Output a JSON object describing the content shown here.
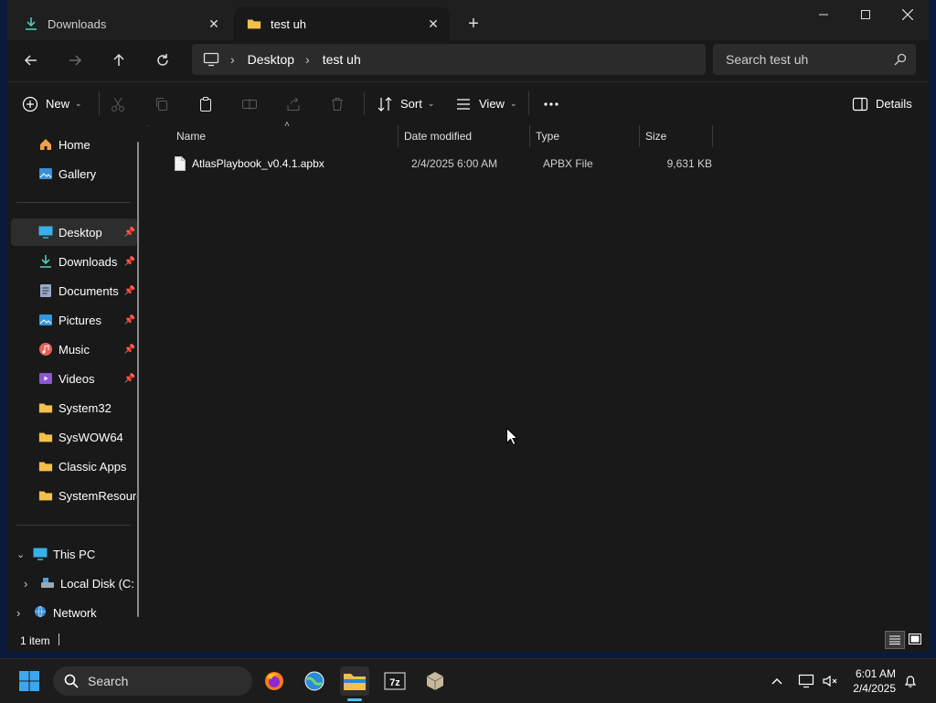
{
  "tabs": [
    {
      "label": "Downloads",
      "icon": "download-icon",
      "active": false
    },
    {
      "label": "test uh",
      "icon": "folder-icon",
      "active": true
    }
  ],
  "address": {
    "segments": [
      "Desktop",
      "test uh"
    ]
  },
  "search": {
    "placeholder": "Search test uh"
  },
  "toolbar": {
    "new_label": "New",
    "sort_label": "Sort",
    "view_label": "View",
    "details_label": "Details"
  },
  "sidebar": {
    "items": [
      {
        "label": "Home",
        "icon": "home-icon"
      },
      {
        "label": "Gallery",
        "icon": "gallery-icon"
      },
      {
        "label": "Desktop",
        "icon": "desktop-icon",
        "pinned": true,
        "selected": true
      },
      {
        "label": "Downloads",
        "icon": "download-icon",
        "pinned": true
      },
      {
        "label": "Documents",
        "icon": "documents-icon",
        "pinned": true
      },
      {
        "label": "Pictures",
        "icon": "pictures-icon",
        "pinned": true
      },
      {
        "label": "Music",
        "icon": "music-icon",
        "pinned": true
      },
      {
        "label": "Videos",
        "icon": "videos-icon",
        "pinned": true
      },
      {
        "label": "System32",
        "icon": "folder-icon"
      },
      {
        "label": "SysWOW64",
        "icon": "folder-icon"
      },
      {
        "label": "Classic Apps",
        "icon": "folder-icon"
      },
      {
        "label": "SystemResourc",
        "icon": "folder-icon"
      }
    ],
    "this_pc": "This PC",
    "local_disk": "Local Disk (C:",
    "network": "Network"
  },
  "columns": [
    "Name",
    "Date modified",
    "Type",
    "Size"
  ],
  "files": [
    {
      "name": "AtlasPlaybook_v0.4.1.apbx",
      "date": "2/4/2025 6:00 AM",
      "type": "APBX File",
      "size": "9,631 KB"
    }
  ],
  "status": {
    "count": "1 item"
  },
  "taskbar": {
    "search_label": "Search",
    "time": "6:01 AM",
    "date": "2/4/2025"
  },
  "colors": {
    "accent": "#4cc2ff",
    "folder": "#f5c04a",
    "window_bg": "#191919"
  }
}
